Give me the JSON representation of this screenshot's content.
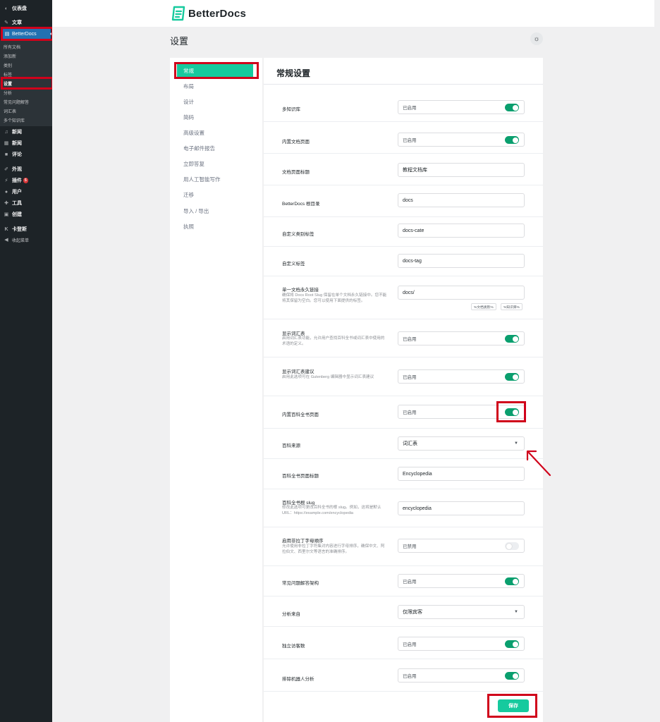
{
  "wp_menu": {
    "dashboard": "仪表盘",
    "posts": "文章",
    "betterdocs": "BetterDocs",
    "submenu": [
      "所有文档",
      "添加新",
      "类别",
      "标签",
      "设置",
      "分析",
      "常见问题解答",
      "词汇表",
      "多个知识库"
    ],
    "media": "新闻",
    "pages": "新闻",
    "comments": "评论",
    "appearance": "外观",
    "plugins": "插件",
    "plugins_badge": "5",
    "users": "用户",
    "tools": "工具",
    "settings": "创建",
    "extra": "卡登斯",
    "collapse": "收起菜单"
  },
  "header": {
    "brand": "BetterDocs",
    "page_title": "设置"
  },
  "tabs": [
    "常规",
    "布局",
    "设计",
    "简码",
    "高级设置",
    "电子邮件报告",
    "立即答复",
    "用人工智能写作",
    "迁移",
    "导入 / 导出",
    "执照"
  ],
  "section_title": "常规设置",
  "rows": [
    {
      "label": "多知识库",
      "value": "已启用",
      "toggle": "on"
    },
    {
      "label": "内置文档页面",
      "value": "已启用",
      "toggle": "on"
    },
    {
      "label": "文档页面标题",
      "value": "教程文档库"
    },
    {
      "label": "BetterDocs 根目录",
      "value": "docs"
    },
    {
      "label": "自定义类别标签",
      "value": "docs-cate"
    },
    {
      "label": "自定义标签",
      "value": "docs-tag"
    },
    {
      "label": "单一文档永久链接",
      "desc": "确保将 Docs Root Slug 保留在单个文档永久链接中。您不能将其保留为空白。您可以使用下面提供的标签。",
      "value": "docs/",
      "tags": [
        "%文档类别%",
        "%知识库%"
      ]
    },
    {
      "label": "显示词汇表",
      "desc": "启用词汇表功能，允许用户查找百科全书或词汇表中使用的术语的定义。",
      "value": "已启用",
      "toggle": "on"
    },
    {
      "label": "显示词汇表建议",
      "desc": "启用此选项可在 Gutenberg 编辑器中显示词汇表建议",
      "value": "已启用",
      "toggle": "on"
    },
    {
      "label": "内置百科全书页面",
      "value": "已启用",
      "toggle": "on"
    },
    {
      "label": "百科来源",
      "value": "词汇表",
      "select": true
    },
    {
      "label": "百科全书页面标题",
      "value": "Encyclopedia"
    },
    {
      "label": "百科全书根 slug",
      "desc": "修改此选项可更改百科全书的根 slug。例如，这将是默认 URL：https://example.com/encyclopedia",
      "value": "encyclopedia"
    },
    {
      "label": "启用非拉丁字母顺序",
      "desc": "允许使用非拉丁字符集对内容进行字母排序，确保中文、阿拉伯文、西里尔文等语言的准确排序。",
      "value": "已禁用",
      "toggle": "off"
    },
    {
      "label": "常见问题解答架构",
      "value": "已启用",
      "toggle": "on"
    },
    {
      "label": "分析来自",
      "value": "仅限宾客",
      "select": true
    },
    {
      "label": "独立访客数",
      "value": "已启用",
      "toggle": "on"
    },
    {
      "label": "排除机器人分析",
      "value": "已启用",
      "toggle": "on"
    }
  ],
  "save_label": "保存",
  "colors": {
    "accent": "#16ca9e",
    "toggle_on": "#0a9f6e",
    "wp_blue": "#2271b1",
    "highlight": "#d0021b"
  }
}
